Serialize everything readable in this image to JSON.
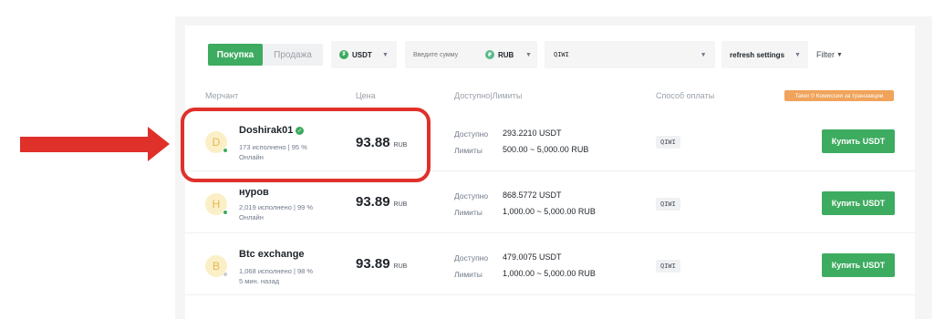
{
  "toolbar": {
    "buy_label": "Покупка",
    "sell_label": "Продажа",
    "asset": "USDT",
    "asset_icon": "tether-coin-icon",
    "amount_placeholder": "Введите сумму",
    "fiat": "RUB",
    "payment": "QIWI",
    "refresh": "refresh settings",
    "filter": "Filter"
  },
  "table": {
    "headers": {
      "merchant": "Мерчант",
      "price": "Цена",
      "available": "Доступно|Лимиты",
      "payment": "Способ оплаты"
    },
    "taker_badge": "Taker 0 Комиссии за транзакции",
    "available_label": "Доступно",
    "limits_label": "Лимиты",
    "rows": [
      {
        "initial": "D",
        "name": "Doshirak01",
        "verified": true,
        "stats": "173 исполнено  |  95 %",
        "status": "Онлайн",
        "online": true,
        "price": "93.88",
        "currency": "RUB",
        "available": "293.2210 USDT",
        "limits": "500.00 ~ 5,000.00 RUB",
        "payment": "QIWI",
        "button": "Купить USDT"
      },
      {
        "initial": "H",
        "name": "нуров",
        "verified": false,
        "stats": "2,019 исполнено  |  99 %",
        "status": "Онлайн",
        "online": true,
        "price": "93.89",
        "currency": "RUB",
        "available": "868.5772 USDT",
        "limits": "1,000.00 ~ 5,000.00 RUB",
        "payment": "QIWI",
        "button": "Купить USDT"
      },
      {
        "initial": "B",
        "name": "Btc exchange",
        "verified": false,
        "stats": "1,068 исполнено  |  98 %",
        "status": "5 мин. назад",
        "online": false,
        "price": "93.89",
        "currency": "RUB",
        "available": "479.0075 USDT",
        "limits": "1,000.00 ~ 5,000.00 RUB",
        "payment": "QIWI",
        "button": "Купить USDT"
      }
    ]
  },
  "colors": {
    "accent_green": "#3dab60",
    "annotation_red": "#e0302a",
    "taker_orange": "#f0a35a"
  }
}
